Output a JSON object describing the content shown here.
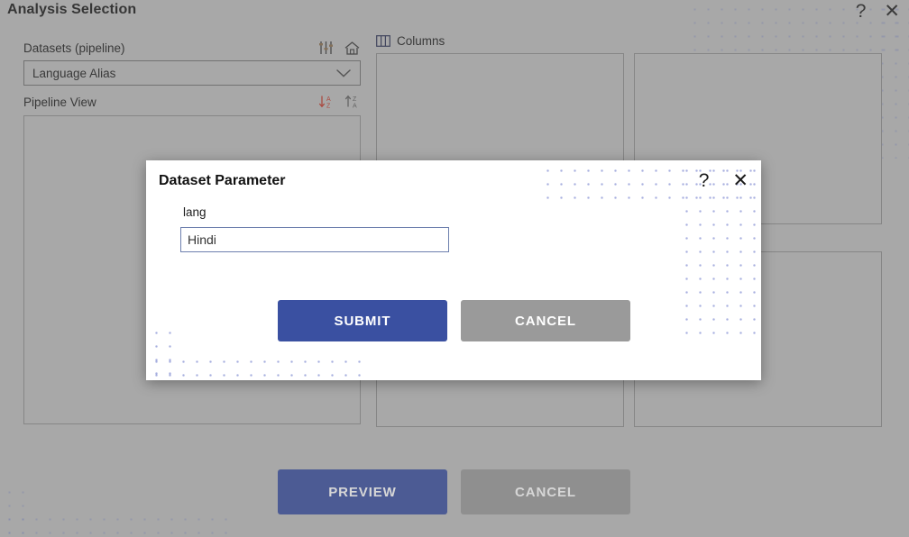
{
  "window": {
    "title": "Analysis Selection",
    "help_icon": "?",
    "close_icon": "✕"
  },
  "left_panel": {
    "datasets_label": "Datasets (pipeline)",
    "filter_icon": "sliders-icon",
    "home_icon": "home-icon",
    "dataset_selected": "Language Alias",
    "dropdown_icon": "chevron-down-icon",
    "pipeline_label": "Pipeline View",
    "sort_asc_icon": "sort-az-icon",
    "sort_desc_icon": "sort-za-icon"
  },
  "middle_panel": {
    "columns_label": "Columns",
    "columns_icon": "columns-grid-icon"
  },
  "footer": {
    "preview_label": "PREVIEW",
    "cancel_label": "CANCEL"
  },
  "modal": {
    "title": "Dataset Parameter",
    "help_icon": "?",
    "close_icon": "✕",
    "param_label": "lang",
    "param_value": "Hindi",
    "param_placeholder": "",
    "submit_label": "SUBMIT",
    "cancel_label": "CANCEL"
  },
  "colors": {
    "app_background": "#bdbdbd",
    "primary_button": "#3a50a1",
    "secondary_button": "#9a9a9a",
    "modal_background": "#ffffff",
    "dot_pattern": "#8a94d4",
    "sort_asc_accent": "#c0392b",
    "panel_border": "#8d8d8d"
  }
}
